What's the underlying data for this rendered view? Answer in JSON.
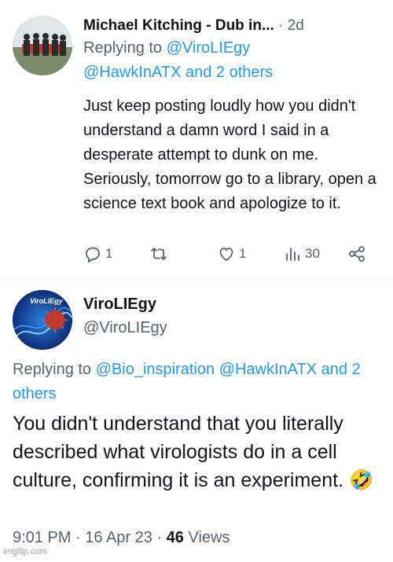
{
  "tweet1": {
    "author_name": "Michael Kitching - Dub in...",
    "time": "2d",
    "reply_prefix": "Replying to",
    "reply_mentions_line1": "@ViroLIEgy",
    "reply_mentions_line2": "@HawkInATX and 2 others",
    "text": "Just keep posting loudly how you didn't understand a damn word I said in a desperate attempt to dunk on me.  Seriously, tomorrow go to a library, open a science text book and apologize to it.",
    "actions": {
      "replies": "1",
      "likes": "1",
      "views": "30"
    }
  },
  "tweet2": {
    "author_name": "ViroLIEgy",
    "handle": "@ViroLIEgy",
    "avatar_text": "ViroLIEgy",
    "reply_prefix": "Replying to",
    "reply_mentions_1": "@Bio_inspiration",
    "reply_mentions_2": "@HawkInATX",
    "reply_mentions_3": "and 2 others",
    "text": "You didn't understand that you literally described what virologists do in a cell culture, confirming it is an experiment. 🤣",
    "time": "9:01 PM",
    "date": "16 Apr 23",
    "views_count": "46",
    "views_label": "Views"
  },
  "watermark": "imgflip.com"
}
